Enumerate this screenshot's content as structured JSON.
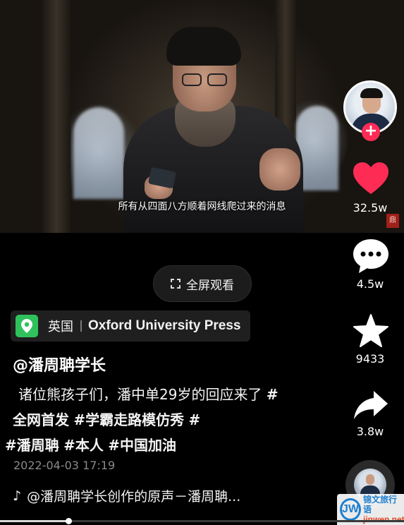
{
  "video": {
    "subtitle": "所有从四面八方顺着网线爬过来的消息",
    "stamp_char": "鼎",
    "progress": 0.17
  },
  "fullscreen_label": "全屏观看",
  "location": {
    "country": "英国",
    "place": "Oxford University Press",
    "icon": "map-pin-icon",
    "color": "#2fc15c"
  },
  "author": "@潘周聃学长",
  "caption": {
    "text": " 诸位熊孩子们，潘中单29岁的回应来了",
    "tags": [
      "#全网首发",
      "#学霸走路模仿秀",
      "#潘周聃",
      "#本人",
      "#中国加油"
    ]
  },
  "date": "2022-04-03 17:19",
  "music": "@潘周聃学长创作的原声－潘周聃...",
  "rail": {
    "likes": "32.5w",
    "comments": "4.5w",
    "favorites": "9433",
    "shares": "3.8w",
    "follow_plus": "+",
    "like_color": "#fe2c55"
  },
  "watermark": {
    "logo": "JW",
    "cn": "锦文旅行语",
    "en": "jinwen.net"
  }
}
